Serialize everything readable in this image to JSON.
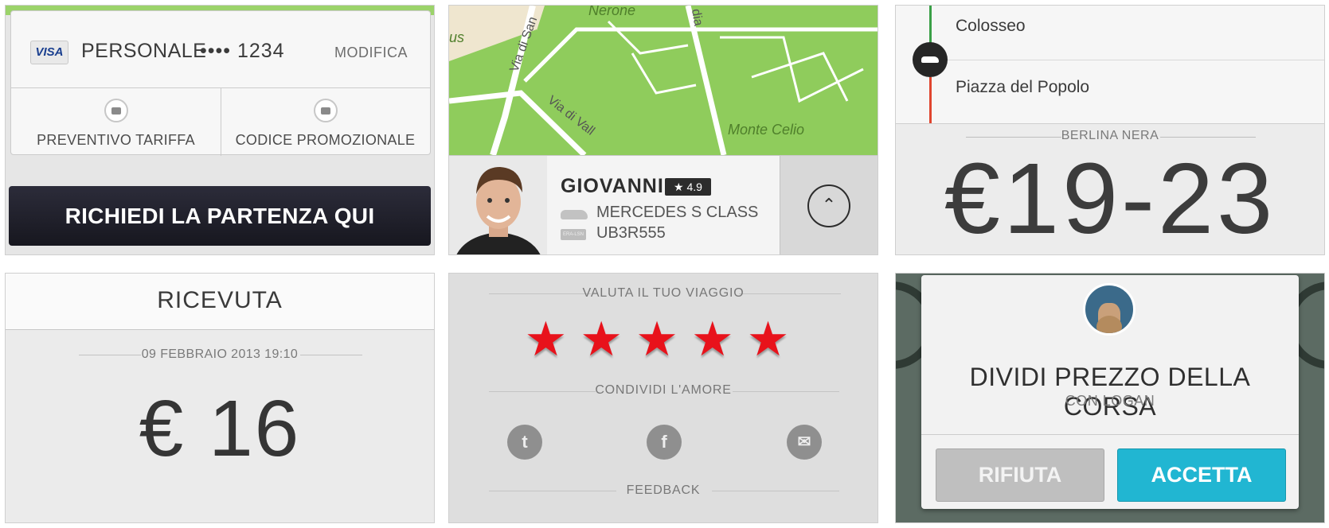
{
  "payment": {
    "card_brand": "VISA",
    "profile": "PERSONALE",
    "card_number": "•••• 1234",
    "edit_label": "MODIFICA",
    "fare_estimate_label": "PREVENTIVO TARIFFA",
    "promo_code_label": "CODICE PROMOZIONALE",
    "request_button": "RICHIEDI LA PARTENZA QUI"
  },
  "map": {
    "labels": [
      "Nerone",
      "Via di San",
      "Via di Vall",
      "Monte Celio",
      "us",
      "dia"
    ]
  },
  "driver": {
    "name": "GIOVANNI",
    "rating": "★ 4.9",
    "car_model": "MERCEDES S CLASS",
    "plate": "UB3R555",
    "plate_icon_text": "ERA-LSN"
  },
  "trip": {
    "pickup": "Colosseo",
    "dropoff": "Piazza del Popolo",
    "vehicle_class": "BERLINA NERA",
    "fare_range": "€19-23"
  },
  "receipt": {
    "title": "RICEVUTA",
    "date": "09 FEBBRAIO 2013 19:10",
    "amount": "€ 16"
  },
  "feedback": {
    "rate_title": "VALUTA IL TUO VIAGGIO",
    "stars": "★★★★★",
    "share_title": "CONDIVIDI L'AMORE",
    "feedback_label": "FEEDBACK",
    "twitter_glyph": "t",
    "facebook_glyph": "f",
    "email_glyph": "✉"
  },
  "split": {
    "title": "DIVIDI PREZZO DELLA CORSA",
    "subtitle": "CON LOGAN",
    "reject_label": "RIFIUTA",
    "accept_label": "ACCETTA"
  },
  "colors": {
    "accent": "#21b6d2",
    "star": "#e8121b",
    "request_button": "#1f1f2b",
    "map_green": "#8fcc5c"
  }
}
